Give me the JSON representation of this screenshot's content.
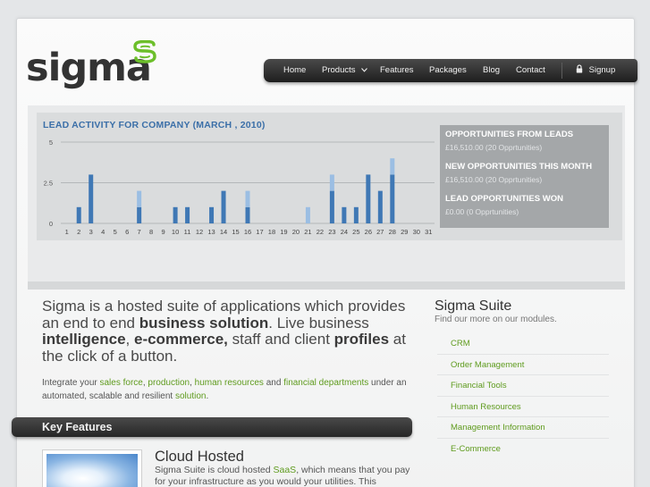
{
  "logo": {
    "text": "sigma"
  },
  "nav": {
    "items": [
      {
        "label": "Home"
      },
      {
        "label": "Products"
      },
      {
        "label": "Features"
      },
      {
        "label": "Packages"
      },
      {
        "label": "Blog"
      },
      {
        "label": "Contact"
      }
    ],
    "signup_label": "Signup"
  },
  "dashboard": {
    "stats": [
      {
        "label": "OPPORTUNITIES FROM LEADS",
        "value": "£16,510.00 (20 Opprtunities)"
      },
      {
        "label": "NEW OPPORTUNITIES THIS MONTH",
        "value": "£16,510.00 (20 Opprtunities)"
      },
      {
        "label": "LEAD OPPORTUNITIES WON",
        "value": "£0.00 (0 Opprtunities)"
      }
    ]
  },
  "chart_data": {
    "type": "bar",
    "title": "LEAD ACTIVITY FOR COMPANY (MARCH , 2010)",
    "xlabel": "",
    "ylabel": "",
    "ylim": [
      0,
      5
    ],
    "yticks": [
      "0",
      "2.5",
      "5"
    ],
    "categories": [
      "1",
      "2",
      "3",
      "4",
      "5",
      "6",
      "7",
      "8",
      "9",
      "10",
      "11",
      "12",
      "13",
      "14",
      "15",
      "16",
      "17",
      "18",
      "19",
      "20",
      "21",
      "22",
      "23",
      "24",
      "25",
      "26",
      "27",
      "28",
      "29",
      "30",
      "31"
    ],
    "series": [
      {
        "values": [
          0,
          1,
          3,
          0,
          0,
          0,
          1,
          0,
          0,
          1,
          1,
          0,
          1,
          2,
          0,
          1,
          0,
          0,
          0,
          0,
          0,
          0,
          2,
          1,
          1,
          3,
          2,
          3,
          0,
          0,
          0
        ],
        "color": "#3f78b5"
      },
      {
        "values": [
          0,
          0,
          0,
          0,
          0,
          0,
          1,
          0,
          0,
          0,
          0,
          0,
          0,
          0,
          0,
          1,
          0,
          0,
          0,
          0,
          1,
          0,
          1,
          0,
          0,
          0,
          0,
          1,
          0,
          0,
          0
        ],
        "color": "#9bbee3"
      }
    ],
    "grid": true
  },
  "intro": {
    "p1_a": "Sigma is a hosted suite of applications which provides an end to end ",
    "p1_b": "business solution",
    "p1_c": ". Live business ",
    "p1_d": "intelligence",
    "p1_e": ", ",
    "p1_f": "e-commerce,",
    "p1_g": " staff and client ",
    "p1_h": "profiles",
    "p1_i": " at the click of a button.",
    "p2_a": "Integrate your ",
    "link_sales": "sales force",
    "p2_b": ", ",
    "link_production": "production",
    "p2_c": ", ",
    "link_hr": "human resources",
    "p2_d": " and ",
    "link_financial": "financial departments",
    "p2_e": " under an automated, scalable and resilient ",
    "link_solution": "solution",
    "p2_f": "."
  },
  "key_features": {
    "title": "Key Features",
    "cloud_title": "Cloud Hosted",
    "cloud_text_a": "Sigma Suite is cloud hosted ",
    "cloud_saas": "SaaS",
    "cloud_text_b": ", which means that you pay for your infrastructure as you would your utilities. This"
  },
  "sidebar": {
    "title": "Sigma Suite",
    "subtitle": "Find our more on our modules.",
    "items": [
      {
        "label": "CRM"
      },
      {
        "label": "Order Management"
      },
      {
        "label": "Financial Tools"
      },
      {
        "label": "Human Resources"
      },
      {
        "label": "Management Information"
      },
      {
        "label": "E-Commerce"
      }
    ]
  },
  "colors": {
    "accent": "#5f9b1e",
    "chart_title": "#3b6fa8",
    "nav_bg": "#2a2a2a"
  }
}
